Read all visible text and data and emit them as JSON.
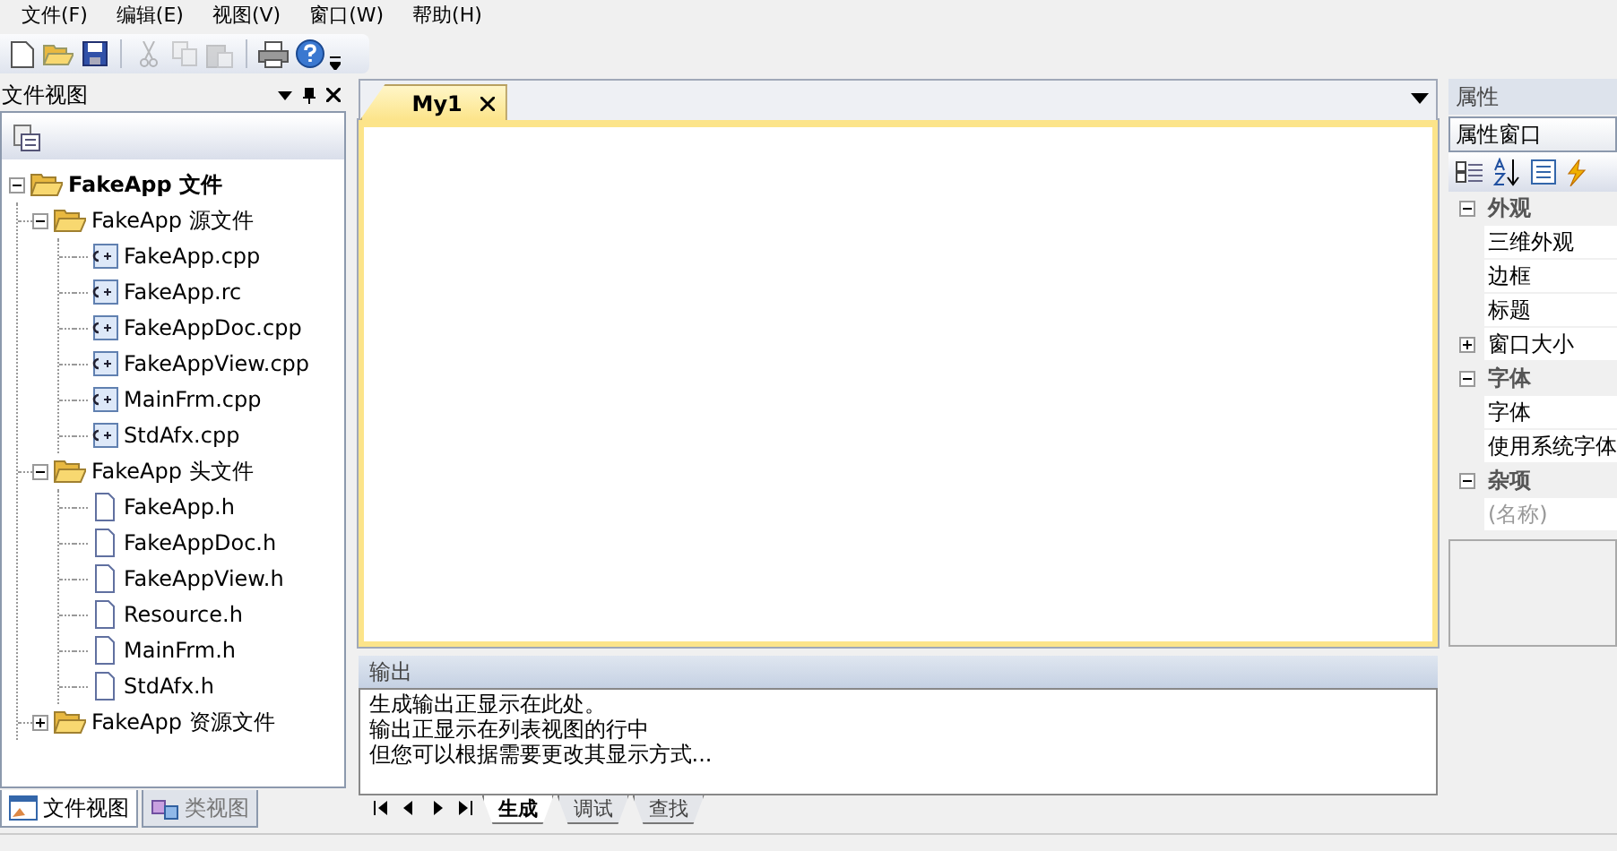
{
  "menu": [
    "文件(F)",
    "编辑(E)",
    "视图(V)",
    "窗口(W)",
    "帮助(H)"
  ],
  "toolbar": [
    {
      "kind": "new",
      "disabled": false
    },
    {
      "kind": "open",
      "disabled": false
    },
    {
      "kind": "save",
      "disabled": false
    },
    {
      "kind": "sep"
    },
    {
      "kind": "cut",
      "disabled": true
    },
    {
      "kind": "copy",
      "disabled": true
    },
    {
      "kind": "paste",
      "disabled": true
    },
    {
      "kind": "sep"
    },
    {
      "kind": "print",
      "disabled": false
    },
    {
      "kind": "help",
      "disabled": false
    }
  ],
  "file_view": {
    "title": "文件视图",
    "tree": [
      {
        "label": "FakeApp 文件",
        "kind": "folder",
        "expanded": true,
        "children": [
          {
            "label": "FakeApp 源文件",
            "kind": "folder",
            "expanded": true,
            "children": [
              {
                "label": "FakeApp.cpp",
                "kind": "cpp"
              },
              {
                "label": "FakeApp.rc",
                "kind": "cpp"
              },
              {
                "label": "FakeAppDoc.cpp",
                "kind": "cpp"
              },
              {
                "label": "FakeAppView.cpp",
                "kind": "cpp"
              },
              {
                "label": "MainFrm.cpp",
                "kind": "cpp"
              },
              {
                "label": "StdAfx.cpp",
                "kind": "cpp"
              }
            ]
          },
          {
            "label": "FakeApp 头文件",
            "kind": "folder",
            "expanded": true,
            "children": [
              {
                "label": "FakeApp.h",
                "kind": "h"
              },
              {
                "label": "FakeAppDoc.h",
                "kind": "h"
              },
              {
                "label": "FakeAppView.h",
                "kind": "h"
              },
              {
                "label": "Resource.h",
                "kind": "h"
              },
              {
                "label": "MainFrm.h",
                "kind": "h"
              },
              {
                "label": "StdAfx.h",
                "kind": "h"
              }
            ]
          },
          {
            "label": "FakeApp 资源文件",
            "kind": "folder",
            "expanded": false
          }
        ]
      }
    ],
    "tabs": [
      {
        "label": "文件视图",
        "selected": true
      },
      {
        "label": "类视图",
        "selected": false
      }
    ]
  },
  "document_tabs": [
    {
      "label": "My1",
      "selected": true
    }
  ],
  "output": {
    "title": "输出",
    "lines": [
      "生成输出正显示在此处。",
      "输出正显示在列表视图的行中",
      "但您可以根据需要更改其显示方式..."
    ],
    "tabs": [
      {
        "label": "生成",
        "selected": true
      },
      {
        "label": "调试",
        "selected": false
      },
      {
        "label": "查找",
        "selected": false
      }
    ]
  },
  "properties": {
    "title": "属性",
    "combo_value": "属性窗口",
    "categories": [
      {
        "label": "外观",
        "expanded": true,
        "items": [
          {
            "label": "三维外观",
            "disabled": false
          },
          {
            "label": "边框",
            "disabled": false
          },
          {
            "label": "标题",
            "disabled": false
          },
          {
            "label": "窗口大小",
            "disabled": false,
            "expanded": false
          }
        ]
      },
      {
        "label": "字体",
        "expanded": true,
        "items": [
          {
            "label": "字体",
            "disabled": false
          },
          {
            "label": "使用系统字体",
            "disabled": false
          }
        ]
      },
      {
        "label": "杂项",
        "expanded": true,
        "items": [
          {
            "label": "(名称)",
            "disabled": true
          }
        ]
      }
    ]
  }
}
